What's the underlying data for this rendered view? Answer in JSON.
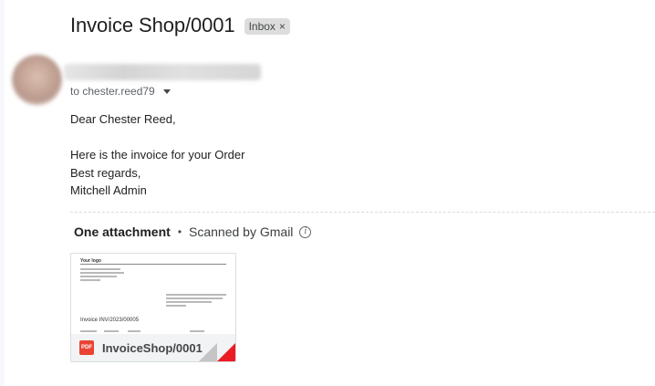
{
  "email": {
    "subject": "Invoice Shop/0001",
    "label": "Inbox",
    "label_remove_icon": "×",
    "to_line": "to chester.reed79",
    "body": {
      "greeting": "Dear Chester Reed,",
      "line1": "Here is the invoice for your Order",
      "line2": "Best regards,",
      "signature": "Mitchell Admin"
    }
  },
  "attachments": {
    "count_label": "One attachment",
    "separator": "•",
    "scan_status": "Scanned by Gmail",
    "info_icon": "info-icon",
    "items": [
      {
        "filename": "InvoiceShop/0001",
        "type_badge": "PDF",
        "preview": {
          "logo_text": "Your logo",
          "invoice_title": "Invoice INV/2023/00005"
        }
      }
    ]
  },
  "colors": {
    "pdf_red": "#ea4335",
    "chip_bg": "#dddddd",
    "muted_text": "#5f6368"
  }
}
